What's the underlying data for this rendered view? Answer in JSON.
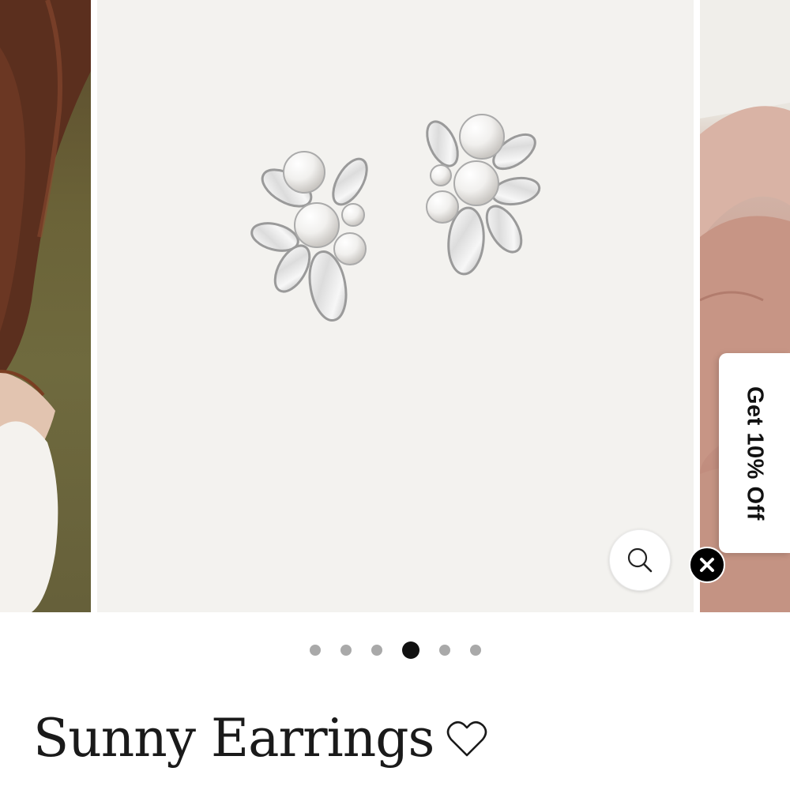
{
  "carousel": {
    "slides": [
      {
        "image": "model-wearing-earrings"
      },
      {
        "image": "pearl-crystal-cluster-earrings-product"
      },
      {
        "image": "earring-held-in-hand"
      }
    ],
    "zoom_icon": "magnifier-icon",
    "pagination": {
      "total": 6,
      "active_index": 3
    }
  },
  "promo": {
    "label": "Get 10% Off",
    "close_icon": "close-icon"
  },
  "product": {
    "title": "Sunny Earrings",
    "wishlist_icon": "heart-outline-icon"
  },
  "colors": {
    "dot_active": "#111111",
    "dot_inactive": "#a9a9a9",
    "image_background": "#f3f2ef",
    "title_text": "#1a1a1a"
  }
}
